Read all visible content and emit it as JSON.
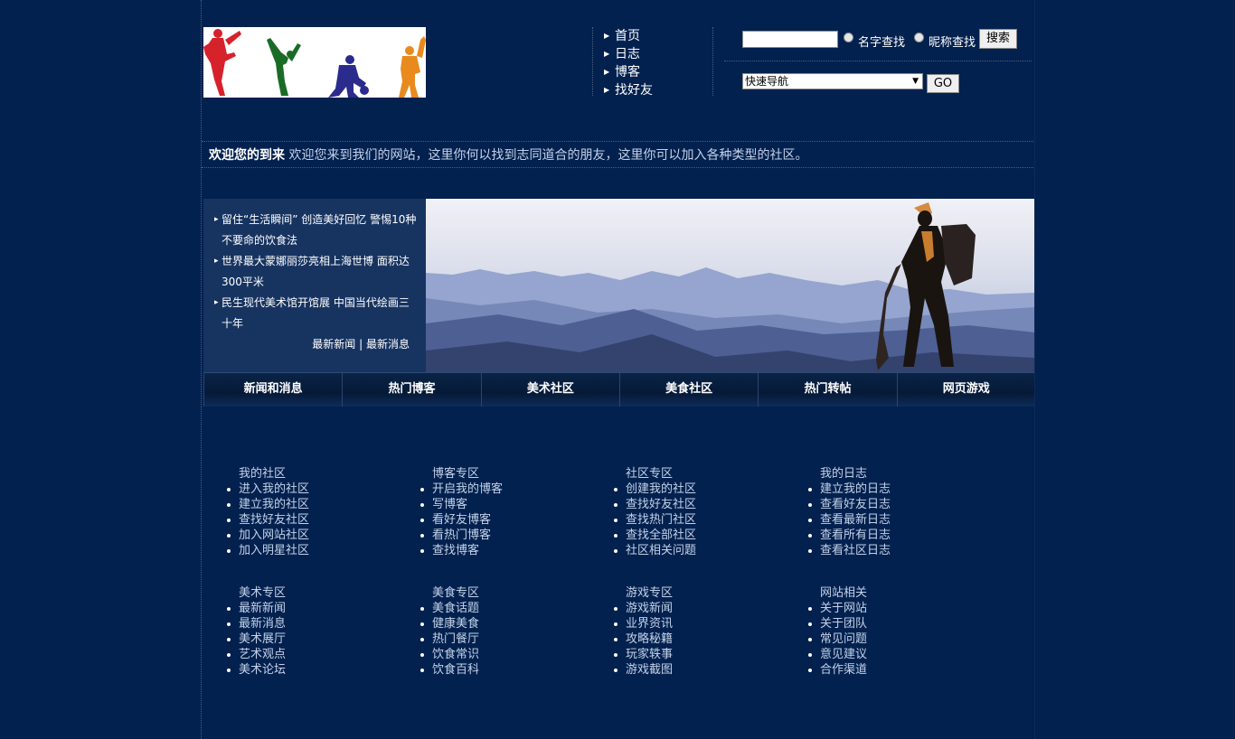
{
  "header": {
    "nav": [
      "首页",
      "日志",
      "博客",
      "找好友"
    ],
    "search": {
      "input_value": "",
      "radio_name": "名字查找",
      "radio_nick": "昵称查找",
      "button": "搜索"
    },
    "quick_nav": {
      "selected": "快速导航",
      "button": "GO"
    }
  },
  "welcome": {
    "title": "欢迎您的到来",
    "text": "欢迎您来到我们的网站，这里你何以找到志同道合的朋友，这里你可以加入各种类型的社区。"
  },
  "news": {
    "items": [
      "留住“生活瞬间” 创造美好回忆 警惕10种不要命的饮食法",
      "世界最大蒙娜丽莎亮相上海世博 面积达300平米",
      "民生现代美术馆开馆展 中国当代绘画三十年"
    ],
    "link_latest_news": "最新新闻",
    "separator": "|",
    "link_latest_messages": "最新消息"
  },
  "tabs": [
    "新闻和消息",
    "热门博客",
    "美术社区",
    "美食社区",
    "热门转帖",
    "网页游戏"
  ],
  "columns": {
    "row1": [
      {
        "title": "我的社区",
        "links": [
          "进入我的社区",
          "建立我的社区",
          "查找好友社区",
          "加入网站社区",
          "加入明星社区"
        ]
      },
      {
        "title": "博客专区",
        "links": [
          "开启我的博客",
          "写博客",
          "看好友博客",
          "看热门博客",
          "查找博客"
        ]
      },
      {
        "title": "社区专区",
        "links": [
          "创建我的社区",
          "查找好友社区",
          "查找热门社区",
          "查找全部社区",
          "社区相关问题"
        ]
      },
      {
        "title": "我的日志",
        "links": [
          "建立我的日志",
          "查看好友日志",
          "查看最新日志",
          "查看所有日志",
          "查看社区日志"
        ]
      }
    ],
    "row2": [
      {
        "title": "美术专区",
        "links": [
          "最新新闻",
          "最新消息",
          "美术展厅",
          "艺术观点",
          "美术论坛"
        ]
      },
      {
        "title": "美食专区",
        "links": [
          "美食话题",
          "健康美食",
          "热门餐厅",
          "饮食常识",
          "饮食百科"
        ]
      },
      {
        "title": "游戏专区",
        "links": [
          "游戏新闻",
          "业界资讯",
          "攻略秘籍",
          "玩家轶事",
          "游戏截图"
        ]
      },
      {
        "title": "网站相关",
        "links": [
          "关于网站",
          "关于团队",
          "常见问题",
          "意见建议",
          "合作渠道"
        ]
      }
    ]
  },
  "colors": {
    "background": "#02214f",
    "news_box": "#173461",
    "link_text": "#c4d2e8"
  },
  "icons": [
    "arrow-right-icon",
    "bullet-icon",
    "dropdown-caret-icon"
  ]
}
